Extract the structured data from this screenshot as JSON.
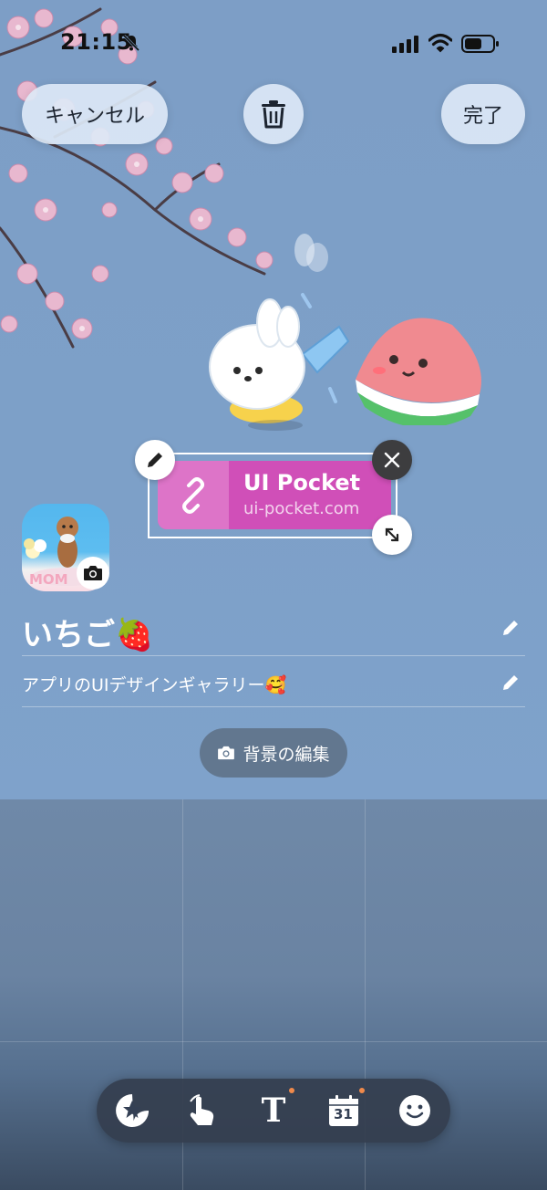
{
  "status_bar": {
    "time": "21:15"
  },
  "top_bar": {
    "cancel_label": "キャンセル",
    "done_label": "完了"
  },
  "link_sticker": {
    "title": "UI Pocket",
    "url": "ui-pocket.com"
  },
  "profile": {
    "name": "いちご🍓",
    "bio": "アプリのUIデザインギャラリー🥰",
    "avatar_text": "MOM"
  },
  "background_edit": {
    "label": "背景の編集"
  },
  "toolbar": {
    "calendar_day": "31",
    "text_tool_glyph": "T",
    "items": [
      "sticker-icon",
      "tap-icon",
      "text-icon",
      "calendar-icon",
      "emoji-icon"
    ]
  },
  "colors": {
    "link_card": "#d04fb8",
    "link_icon_box": "#dd74c8",
    "badge_dot": "#f08a4b"
  }
}
